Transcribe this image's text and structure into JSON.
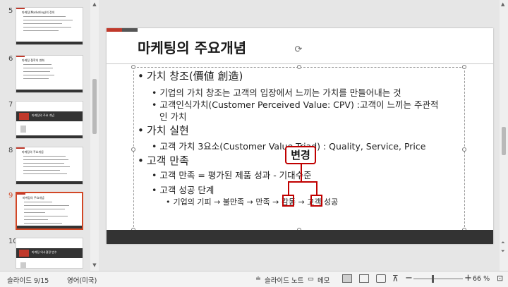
{
  "thumbnails": [
    {
      "num": "5",
      "title": "마케팅(Marketing)의 정의"
    },
    {
      "num": "6",
      "title": "마케팅 철학의 변화"
    },
    {
      "num": "7",
      "title": "마케팅의 주요 개념",
      "chapter_label": "Chapter"
    },
    {
      "num": "8",
      "title": "마케팅의 주요개념"
    },
    {
      "num": "9",
      "title": "마케팅의 주요개념",
      "selected": true
    },
    {
      "num": "10",
      "title": "마케팅 의사결정 변수",
      "chapter_label": "Chapter"
    }
  ],
  "slide": {
    "title": "마케팅의 주요개념",
    "lines": [
      {
        "level": 1,
        "bullet": "•",
        "text": "가치 창조(價値 創造)"
      },
      {
        "level": 2,
        "bullet": "•",
        "text": "기업의 가치 창조는 고객의 입장에서 느끼는 가치를 만들어내는 것"
      },
      {
        "level": 2,
        "bullet": "•",
        "text": "고객인식가치(Customer Perceived Value: CPV) :고객이 느끼는 주관적"
      },
      {
        "level": 2,
        "bullet": "",
        "text": "인 가치"
      },
      {
        "level": 1,
        "bullet": "•",
        "text": "가치 실현"
      },
      {
        "level": 2,
        "bullet": "•",
        "text": "고객 가치 3요소(Customer Value Triad) : Quality, Service, Price"
      },
      {
        "level": 1,
        "bullet": "•",
        "text": "고객 만족"
      },
      {
        "level": 2,
        "bullet": "•",
        "text": "고객 만족 = 평가된 제품 성과 - 기대수준"
      },
      {
        "level": 2,
        "bullet": "•",
        "text": "고객 성공 단계"
      },
      {
        "level": 3,
        "bullet": "•",
        "text": "기업의 기피 → 불만족 → 만족 → 감동 → 고객 성공"
      }
    ],
    "callout": "변경",
    "accent_color": "#c00000"
  },
  "status_bar": {
    "slide_info": "슬라이드 9/15",
    "language": "영어(미국)",
    "notes_label": "슬라이드 노트",
    "comments_label": "메모",
    "zoom_minus": "−",
    "zoom_plus": "+",
    "zoom_level": "66 %"
  }
}
